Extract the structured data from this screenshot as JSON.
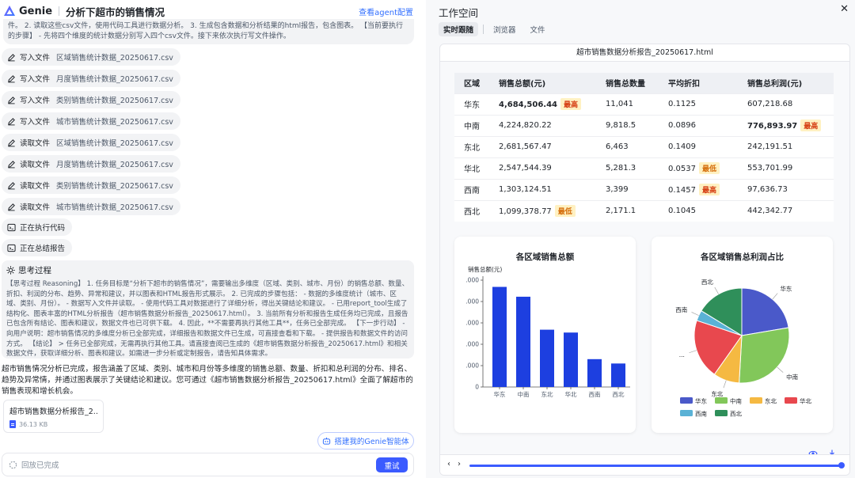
{
  "app": {
    "name": "Genie",
    "conversation_title": "分析下超市的销售情况",
    "agent_config_link": "查看agent配置"
  },
  "task_text": "件。 2. 读取这些csv文件，使用代码工具进行数据分析。 3. 生成包含数据和分析结果的html报告，包含图表。 【当前要执行的步骤】 - 先将四个维度的统计数据分别写入四个csv文件。接下来依次执行写文件操作。",
  "actions": [
    {
      "label": "写入文件",
      "file": "区域销售统计数据_20250617.csv",
      "icon": "edit-icon"
    },
    {
      "label": "写入文件",
      "file": "月度销售统计数据_20250617.csv",
      "icon": "edit-icon"
    },
    {
      "label": "写入文件",
      "file": "类别销售统计数据_20250617.csv",
      "icon": "edit-icon"
    },
    {
      "label": "写入文件",
      "file": "城市销售统计数据_20250617.csv",
      "icon": "edit-icon"
    },
    {
      "label": "读取文件",
      "file": "区域销售统计数据_20250617.csv",
      "icon": "edit-icon"
    },
    {
      "label": "读取文件",
      "file": "月度销售统计数据_20250617.csv",
      "icon": "edit-icon"
    },
    {
      "label": "读取文件",
      "file": "类别销售统计数据_20250617.csv",
      "icon": "edit-icon"
    },
    {
      "label": "读取文件",
      "file": "城市销售统计数据_20250617.csv",
      "icon": "edit-icon"
    },
    {
      "label": "正在执行代码",
      "file": "",
      "icon": "code-icon"
    },
    {
      "label": "正在总结报告",
      "file": "",
      "icon": "code-icon"
    }
  ],
  "thinking": {
    "title": "思考过程",
    "body": "【思考过程 Reasoning】 1. 任务目标是“分析下超市的销售情况”，需要输出多维度（区域、类别、城市、月份）的销售总额、数量、折扣、利润的分布、趋势、异常和建议，并以图表和HTML报告形式展示。 2. 已完成的步骤包括： - 数据的多维度统计（城市、区域、类别、月份）。 - 数据写入文件并读取。 - 使用代码工具对数据进行了详细分析，得出关键结论和建议。 - 已用report_tool生成了结构化、图表丰富的HTML分析报告（超市销售数据分析报告_20250617.html）。 3. 当前所有分析和报告生成任务均已完成，且报告已包含所有结论、图表和建议，数据文件也已可供下载。 4. 因此，**不需要再执行其他工具**，任务已全部完成。 【下一步行动】 - 向用户说明：超市销售情况的多维度分析已全部完成，详细报告和数据文件已生成，可直接查看和下载。 - 提供报告和数据文件的访问方式。 【结论】 > 任务已全部完成，无需再执行其他工具。请直接查阅已生成的《超市销售数据分析报告_20250617.html》和相关数据文件，获取详细分析、图表和建议。如需进一步分析或定制报告，请告知具体需求。"
  },
  "answer": "超市销售情况分析已完成，报告涵盖了区域、类别、城市和月份等多维度的销售总额、数量、折扣和总利润的分布、排名、趋势及异常情，并通过图表展示了关键结论和建议。您可通过《超市销售数据分析报告_20250617.html》全面了解超市的销售表现和增长机会。",
  "file_card": {
    "name": "超市销售数据分析报告_2...",
    "size": "36.13 KB"
  },
  "build_agent_button": "搭建我的Genie智能体",
  "input": {
    "status": "回放已完成",
    "send_label": "重试"
  },
  "workspace": {
    "title": "工作空间",
    "tabs": [
      "实时跟随",
      "浏览器",
      "文件"
    ],
    "active_tab": "实时跟随",
    "doc_title": "超市销售数据分析报告_20250617.html",
    "table": {
      "headers": [
        "区域",
        "销售总额(元)",
        "销售总数量",
        "平均折扣",
        "销售总利润(元)"
      ],
      "rows": [
        {
          "region": "华东",
          "sales": "4,684,506.44",
          "sales_tag": "最高",
          "qty": "11,041",
          "qty_tag": "",
          "disc": "0.1125",
          "disc_tag": "",
          "profit": "607,218.68",
          "profit_tag": ""
        },
        {
          "region": "中南",
          "sales": "4,224,820.22",
          "sales_tag": "",
          "qty": "9,818.5",
          "qty_tag": "",
          "disc": "0.0896",
          "disc_tag": "",
          "profit": "776,893.97",
          "profit_tag": "最高"
        },
        {
          "region": "东北",
          "sales": "2,681,567.47",
          "sales_tag": "",
          "qty": "6,463",
          "qty_tag": "",
          "disc": "0.1409",
          "disc_tag": "",
          "profit": "242,191.51",
          "profit_tag": ""
        },
        {
          "region": "华北",
          "sales": "2,547,544.39",
          "sales_tag": "",
          "qty": "5,281.3",
          "qty_tag": "",
          "disc": "0.0537",
          "disc_tag": "最低",
          "profit": "553,701.99",
          "profit_tag": ""
        },
        {
          "region": "西南",
          "sales": "1,303,124.51",
          "sales_tag": "",
          "qty": "3,399",
          "qty_tag": "",
          "disc": "0.1457",
          "disc_tag": "最高",
          "profit": "97,636.73",
          "profit_tag": ""
        },
        {
          "region": "西北",
          "sales": "1,099,378.77",
          "sales_tag": "最低",
          "qty": "2,171.1",
          "qty_tag": "",
          "disc": "0.1045",
          "disc_tag": "",
          "profit": "442,342.77",
          "profit_tag": ""
        }
      ]
    },
    "progress": 1.0
  },
  "colors": {
    "accent": "#3b5bff",
    "bar": "#1d3fe0",
    "pie": [
      "#4a59c9",
      "#82c75a",
      "#f5b942",
      "#e8484e",
      "#5ab2d6",
      "#2f8f5a"
    ]
  },
  "chart_data": [
    {
      "type": "bar",
      "title": "各区域销售总额",
      "ylabel": "销售总额(元)",
      "categories": [
        "华东",
        "中南",
        "东北",
        "华北",
        "西南",
        "西北"
      ],
      "values": [
        4684506.44,
        4224820.22,
        2681567.47,
        2547544.39,
        1303124.51,
        1099378.77
      ],
      "ylim": [
        0,
        5000000
      ],
      "ytick_labels": [
        "0",
        ".000",
        ".000",
        ".000",
        ".000",
        ".000"
      ],
      "grid": false
    },
    {
      "type": "pie",
      "title": "各区域销售总利润占比",
      "categories": [
        "华东",
        "中南",
        "东北",
        "华北",
        "西南",
        "西北"
      ],
      "values": [
        607218.68,
        776893.97,
        242191.51,
        553701.99,
        97636.73,
        442342.77
      ],
      "slice_labels": [
        "华东",
        "中南",
        "东北",
        "...",
        "西南",
        "西北"
      ],
      "legend_position": "bottom"
    }
  ]
}
